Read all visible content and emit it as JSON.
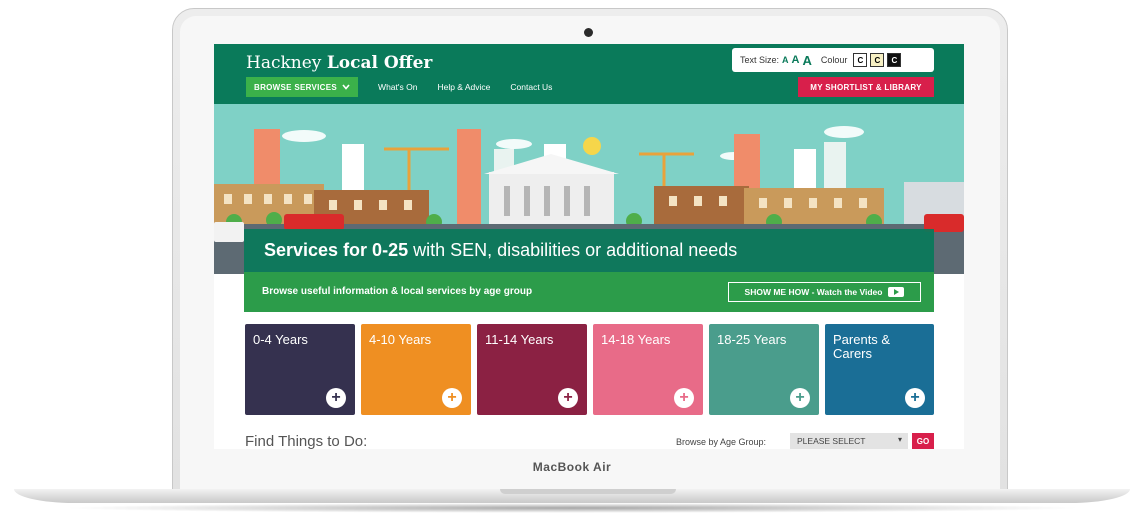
{
  "device": {
    "model_label": "MacBook Air"
  },
  "site": {
    "brand_prefix": "Hackney",
    "brand_bold": "Local Offer",
    "accessibility": {
      "text_size_label": "Text Size:",
      "size_options": [
        "A",
        "A",
        "A"
      ],
      "colour_label": "Colour",
      "colour_options": [
        "C",
        "C",
        "C"
      ]
    },
    "nav": {
      "browse_label": "BROWSE SERVICES",
      "links": [
        "What's On",
        "Help & Advice",
        "Contact Us"
      ],
      "shortlist_label": "MY SHORTLIST & LIBRARY"
    },
    "hero": {
      "title_bold": "Services for 0-25",
      "title_rest": " with SEN, disabilities or additional needs",
      "subtitle": "Browse useful information & local services by age group",
      "video_button": "SHOW ME HOW - Watch the Video"
    },
    "tiles": [
      {
        "label": "0-4 Years",
        "color": "#35314f"
      },
      {
        "label": "4-10 Years",
        "color": "#ef8f22"
      },
      {
        "label": "11-14 Years",
        "color": "#8b2143"
      },
      {
        "label": "14-18 Years",
        "color": "#e86b88"
      },
      {
        "label": "18-25 Years",
        "color": "#4a9d8c"
      },
      {
        "label": "Parents & Carers",
        "color": "#1a6e96"
      }
    ],
    "find": {
      "heading": "Find Things to Do:",
      "age_group_label": "Browse by Age Group:",
      "select_value": "PLEASE SELECT",
      "go_label": "GO"
    },
    "colors": {
      "header_green": "#0a7a5a",
      "accent_green": "#3bb14a",
      "accent_pink": "#d81f4b"
    }
  }
}
